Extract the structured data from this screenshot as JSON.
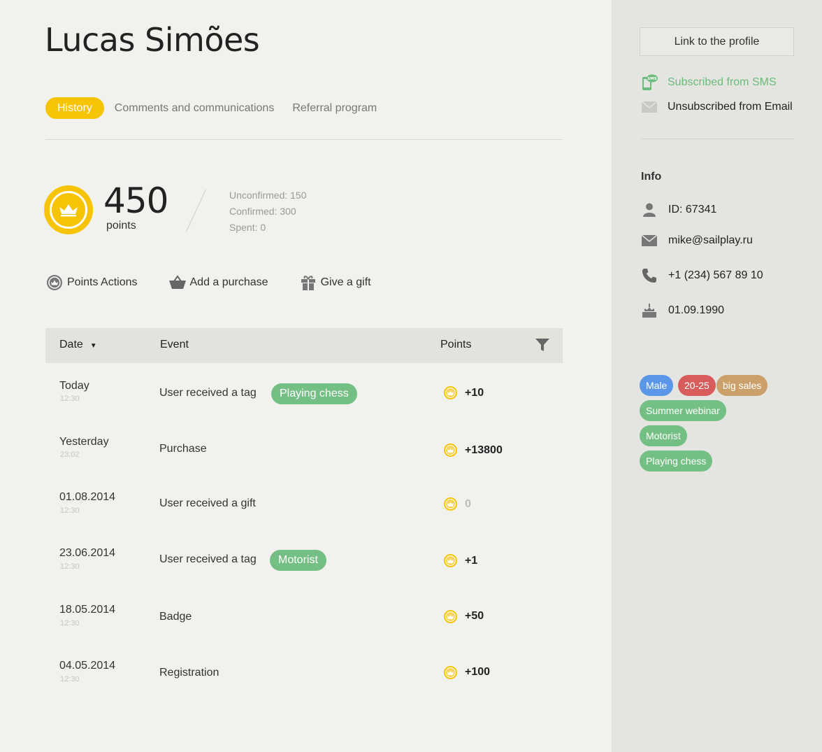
{
  "profile": {
    "name": "Lucas Simões"
  },
  "tabs": [
    {
      "label": "History",
      "active": true
    },
    {
      "label": "Comments and communications",
      "active": false
    },
    {
      "label": "Referral program",
      "active": false
    }
  ],
  "points": {
    "value": "450",
    "caption": "points",
    "unconfirmed": "Unconfirmed: 150",
    "confirmed": "Confirmed: 300",
    "spent": "Spent: 0"
  },
  "actions": [
    {
      "label": "Points Actions",
      "icon": "points-icon"
    },
    {
      "label": "Add a purchase",
      "icon": "basket-icon"
    },
    {
      "label": "Give a gift",
      "icon": "gift-icon"
    }
  ],
  "table": {
    "headers": {
      "date": "Date",
      "event": "Event",
      "points": "Points"
    },
    "rows": [
      {
        "date": "Today",
        "time": "12:30",
        "event": "User received a tag",
        "tag": "Playing chess",
        "points": "+10"
      },
      {
        "date": "Yesterday",
        "time": "23:02",
        "event": "Purchase",
        "tag": "",
        "points": "+13800"
      },
      {
        "date": "01.08.2014",
        "time": "12:30",
        "event": "User received a gift",
        "tag": "",
        "points": "0"
      },
      {
        "date": "23.06.2014",
        "time": "12:30",
        "event": "User received a tag",
        "tag": "Motorist",
        "points": "+1"
      },
      {
        "date": "18.05.2014",
        "time": "12:30",
        "event": "Badge",
        "tag": "",
        "points": "+50"
      },
      {
        "date": "04.05.2014",
        "time": "12:30",
        "event": "Registration",
        "tag": "",
        "points": "+100"
      }
    ]
  },
  "sidebar": {
    "link_button": "Link to the profile",
    "sms_status": "Subscribed from SMS",
    "email_status": "Unsubscribed from Email",
    "info_title": "Info",
    "id": "ID: 67341",
    "email": "mike@sailplay.ru",
    "phone": "+1 (234) 567 89 10",
    "birthday": "01.09.1990",
    "tags": [
      {
        "label": "Male",
        "color": "#5b97e8"
      },
      {
        "label": "20-25",
        "color": "#d95c5c"
      },
      {
        "label": "big sales",
        "color": "#cba06a"
      },
      {
        "label": "Summer webinar",
        "color": "#74bf84"
      },
      {
        "label": "Motorist",
        "color": "#74bf84"
      },
      {
        "label": "Playing chess",
        "color": "#74bf84"
      }
    ]
  },
  "colors": {
    "accent": "#f6c404",
    "green": "#74bf84",
    "sidebar_bg": "#e4e4e0",
    "main_bg": "#f1f1ed"
  }
}
